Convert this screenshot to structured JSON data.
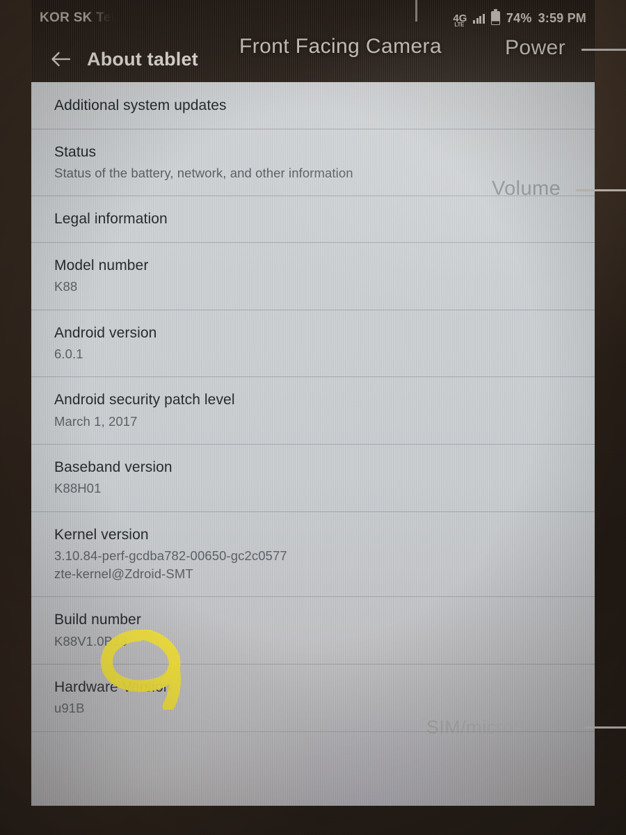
{
  "status_bar": {
    "carrier": "KOR SK Tel",
    "network_icon": "4g-lte-icon",
    "network_label": "4G",
    "network_sublabel": "LTE",
    "signal_icon": "signal-bars-icon",
    "battery_icon": "battery-icon",
    "battery_percent": "74%",
    "clock": "3:59 PM"
  },
  "app_bar": {
    "back_icon": "back-arrow-icon",
    "title": "About tablet"
  },
  "settings_list": [
    {
      "title": "Additional system updates",
      "subtitle": "",
      "subtitle_line2": ""
    },
    {
      "title": "Status",
      "subtitle": "Status of the battery, network, and other information",
      "subtitle_line2": ""
    },
    {
      "title": "Legal information",
      "subtitle": "",
      "subtitle_line2": ""
    },
    {
      "title": "Model number",
      "subtitle": "K88",
      "subtitle_line2": ""
    },
    {
      "title": "Android version",
      "subtitle": "6.0.1",
      "subtitle_line2": ""
    },
    {
      "title": "Android security patch level",
      "subtitle": "March 1, 2017",
      "subtitle_line2": ""
    },
    {
      "title": "Baseband version",
      "subtitle": "K88H01",
      "subtitle_line2": ""
    },
    {
      "title": "Kernel version",
      "subtitle": "3.10.84-perf-gcdba782-00650-gc2c0577",
      "subtitle_line2": "zte-kernel@Zdroid-SMT"
    },
    {
      "title": "Build number",
      "subtitle": "K88V1.0B33",
      "subtitle_line2": ""
    },
    {
      "title": "Hardware Version",
      "subtitle": "u91B",
      "subtitle_line2": ""
    }
  ],
  "annotations": {
    "camera": "Front Facing Camera",
    "power": "Power",
    "volume": "Volume",
    "sim": "SIM/microSD",
    "marker_color": "#f2e23d",
    "marker_target": "Build number"
  },
  "colors": {
    "bezel": "#2f241c",
    "status_bar_bg": "#261d17",
    "list_bg": "#ced2d5",
    "title_text": "#24282b",
    "subtitle_text": "#5b6065",
    "appbar_text": "#e7e2dc",
    "highlight_yellow": "#f2e23d"
  }
}
